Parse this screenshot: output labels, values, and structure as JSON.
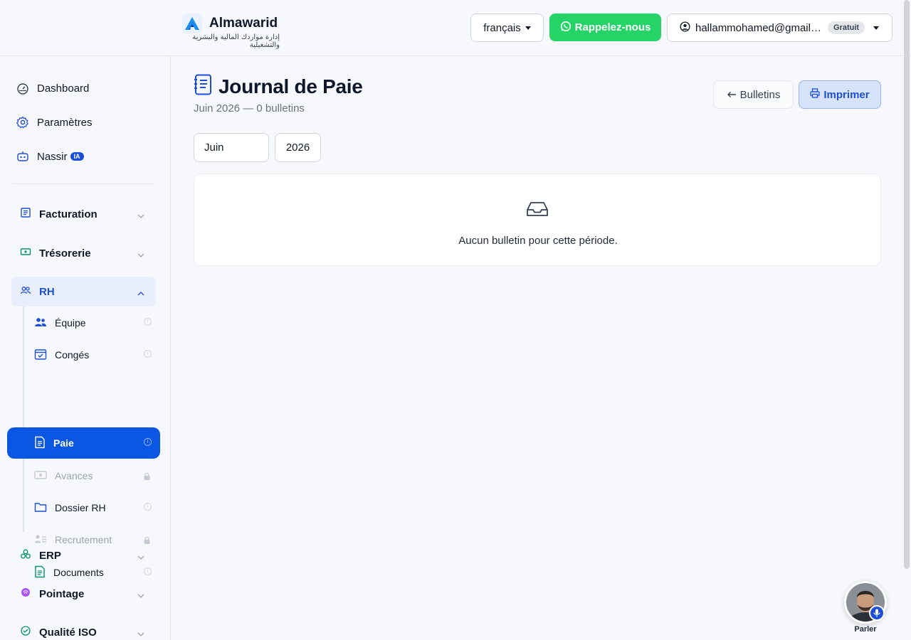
{
  "header": {
    "app_name": "Almawarid",
    "app_tagline": "إدارة مواردك المالية والبشرية والتشغيلية",
    "language": "français",
    "callback_label": "Rappelez-nous",
    "user_email": "hallammohamed@gmail.com",
    "plan_badge": "Gratuit"
  },
  "sidebar": {
    "top_items": [
      {
        "label": "Dashboard",
        "icon": "gauge-icon"
      },
      {
        "label": "Paramètres",
        "icon": "gear-icon"
      },
      {
        "label": "Nassir",
        "icon": "robot-icon",
        "badge": "IA"
      }
    ],
    "groups": [
      {
        "label": "Facturation",
        "icon": "receipt-icon",
        "expanded": false
      },
      {
        "label": "Trésorerie",
        "icon": "cash-icon",
        "expanded": false
      },
      {
        "label": "RH",
        "icon": "users-icon",
        "expanded": true
      },
      {
        "label": "ERP",
        "icon": "cubes-icon",
        "expanded": false
      },
      {
        "label": "Pointage",
        "icon": "fingerprint-icon",
        "expanded": false
      },
      {
        "label": "Qualité ISO",
        "icon": "check-circle-icon",
        "expanded": false
      }
    ],
    "rh_items": [
      {
        "label": "Équipe",
        "icon": "team-icon",
        "state": "normal"
      },
      {
        "label": "Congés",
        "icon": "calendar-check-icon",
        "state": "normal"
      },
      {
        "label": "Paie",
        "icon": "payslip-icon",
        "state": "active"
      },
      {
        "label": "Avances",
        "icon": "money-icon",
        "state": "locked"
      },
      {
        "label": "Dossier RH",
        "icon": "folder-icon",
        "state": "normal"
      },
      {
        "label": "Recrutement",
        "icon": "user-list-icon",
        "state": "locked"
      },
      {
        "label": "Documents",
        "icon": "document-icon",
        "state": "normal"
      }
    ]
  },
  "main": {
    "title": "Journal de Paie",
    "subtitle": "Juin 2026 — 0 bulletins",
    "back_label": "Bulletins",
    "print_label": "Imprimer",
    "month_value": "Juin",
    "year_value": "2026",
    "empty_message": "Aucun bulletin pour cette période."
  },
  "assistant": {
    "label": "Parler"
  },
  "colors": {
    "primary": "#0b57e3",
    "whatsapp": "#25d366",
    "background": "#f6f8fb"
  }
}
